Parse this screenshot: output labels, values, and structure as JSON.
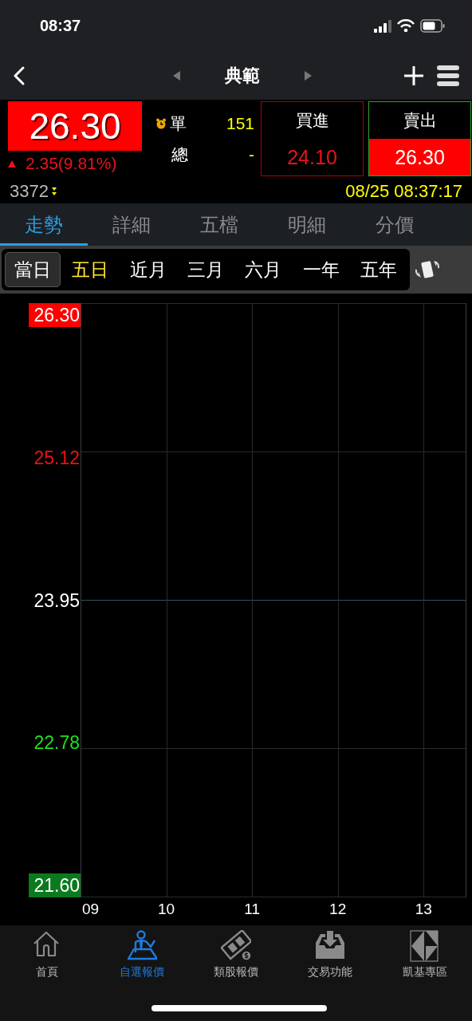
{
  "status_bar": {
    "time": "08:37"
  },
  "nav": {
    "title": "典範"
  },
  "quote": {
    "price": "26.30",
    "rising": true,
    "change": "2.35(9.81%)",
    "single_label": "單",
    "single_value": "151",
    "total_label": "總",
    "total_value": "-",
    "code": "3372",
    "datetime": "08/25 08:37:17"
  },
  "bid": {
    "label": "買進",
    "price": "24.10"
  },
  "ask": {
    "label": "賣出",
    "price": "26.30"
  },
  "tabs": [
    {
      "label": "走勢",
      "selected": true
    },
    {
      "label": "詳細",
      "selected": false
    },
    {
      "label": "五檔",
      "selected": false
    },
    {
      "label": "明細",
      "selected": false
    },
    {
      "label": "分價",
      "selected": false
    }
  ],
  "ranges": [
    {
      "label": "當日",
      "selected": true,
      "highlighted": false
    },
    {
      "label": "五日",
      "selected": false,
      "highlighted": true
    },
    {
      "label": "近月",
      "selected": false,
      "highlighted": false
    },
    {
      "label": "三月",
      "selected": false,
      "highlighted": false
    },
    {
      "label": "六月",
      "selected": false,
      "highlighted": false
    },
    {
      "label": "一年",
      "selected": false,
      "highlighted": false
    },
    {
      "label": "五年",
      "selected": false,
      "highlighted": false
    }
  ],
  "chart": {
    "y_labels": [
      {
        "label": "26.30",
        "kind": "limit-up"
      },
      {
        "label": "25.12",
        "kind": "up"
      },
      {
        "label": "23.95",
        "kind": "flat"
      },
      {
        "label": "22.78",
        "kind": "down"
      },
      {
        "label": "21.60",
        "kind": "limit-down"
      }
    ],
    "x_labels": [
      "09",
      "10",
      "11",
      "12",
      "13"
    ]
  },
  "bottom_nav": [
    {
      "label": "首頁",
      "kind": "home",
      "selected": false
    },
    {
      "label": "自選報價",
      "kind": "person",
      "selected": true
    },
    {
      "label": "類股報價",
      "kind": "film",
      "selected": false
    },
    {
      "label": "交易功能",
      "kind": "tray",
      "selected": false
    },
    {
      "label": "凱基專區",
      "kind": "logo",
      "selected": false
    }
  ]
}
